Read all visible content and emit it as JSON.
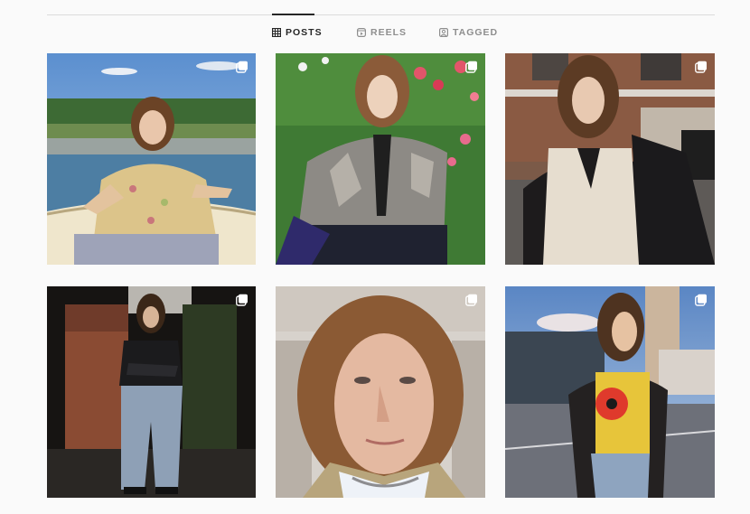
{
  "profile_tabs": {
    "posts_label": "POSTS",
    "reels_label": "REELS",
    "tagged_label": "TAGGED",
    "active": "POSTS"
  },
  "posts": [
    {
      "type": "carousel"
    },
    {
      "type": "carousel"
    },
    {
      "type": "carousel"
    },
    {
      "type": "carousel"
    },
    {
      "type": "carousel"
    },
    {
      "type": "carousel"
    }
  ],
  "colors": {
    "background": "#fafafa",
    "active_tab": "#262626",
    "inactive_tab": "#8e8e8e",
    "divider": "#dbdbdb"
  },
  "icons": {
    "posts_tab": "grid-icon",
    "reels_tab": "reels-icon",
    "tagged_tab": "tagged-icon",
    "post_badge": "multiple-posts-icon"
  }
}
